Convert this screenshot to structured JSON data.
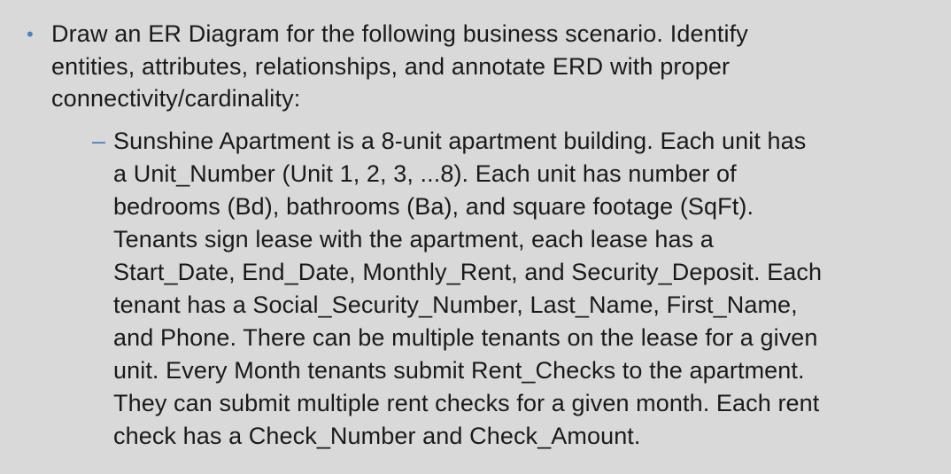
{
  "question": {
    "bullet_marker": "•",
    "lines": [
      "Draw an ER Diagram for the following business scenario. Identify",
      "entities, attributes, relationships, and annotate ERD with proper",
      "connectivity/cardinality:"
    ]
  },
  "scenario": {
    "dash_marker": "–",
    "lines": [
      "Sunshine Apartment is a 8-unit apartment building. Each unit has",
      "a Unit_Number (Unit 1, 2, 3, ...8). Each unit has number of",
      "bedrooms (Bd), bathrooms (Ba), and square footage (SqFt).",
      "Tenants sign lease with the apartment, each lease has a",
      "Start_Date, End_Date, Monthly_Rent, and Security_Deposit. Each",
      "tenant has a Social_Security_Number, Last_Name, First_Name,",
      "and Phone. There can be multiple tenants on the lease for a given",
      "unit. Every Month tenants submit Rent_Checks to the apartment.",
      "They can submit multiple rent checks for a given month. Each rent",
      "check has a Check_Number and Check_Amount."
    ]
  },
  "colors": {
    "background": "#d9d9d9",
    "text": "#1a1a1a",
    "bullet_accent": "#4f81bd"
  }
}
